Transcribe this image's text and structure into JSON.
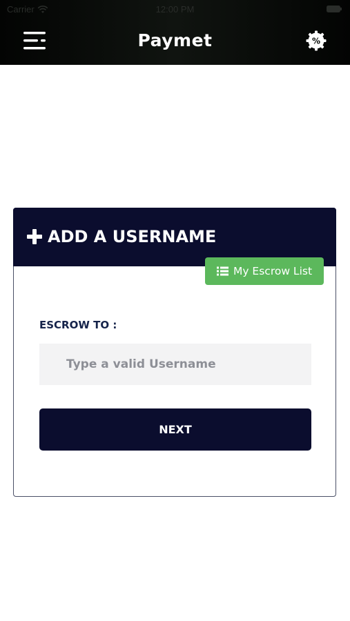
{
  "status_bar": {
    "carrier": "Carrier",
    "time": "12:00 PM"
  },
  "nav": {
    "title": "Paymet",
    "discount_symbol": "%",
    "menu_icon": "menu-icon",
    "discount_icon": "percent-gear-icon"
  },
  "card": {
    "title": "ADD A USERNAME",
    "title_icon": "plus-icon",
    "escrow_list_label": "My Escrow List",
    "escrow_list_icon": "list-icon",
    "field_label": "ESCROW TO :",
    "input_placeholder": "Type a valid Username",
    "input_value": "",
    "next_label": "NEXT"
  },
  "colors": {
    "header_bg": "#0b0d2e",
    "topbar_bg": "#0a0d0a",
    "accent_green": "#5cb85c",
    "input_bg": "#f3f3f4",
    "label_color": "#15234a"
  }
}
